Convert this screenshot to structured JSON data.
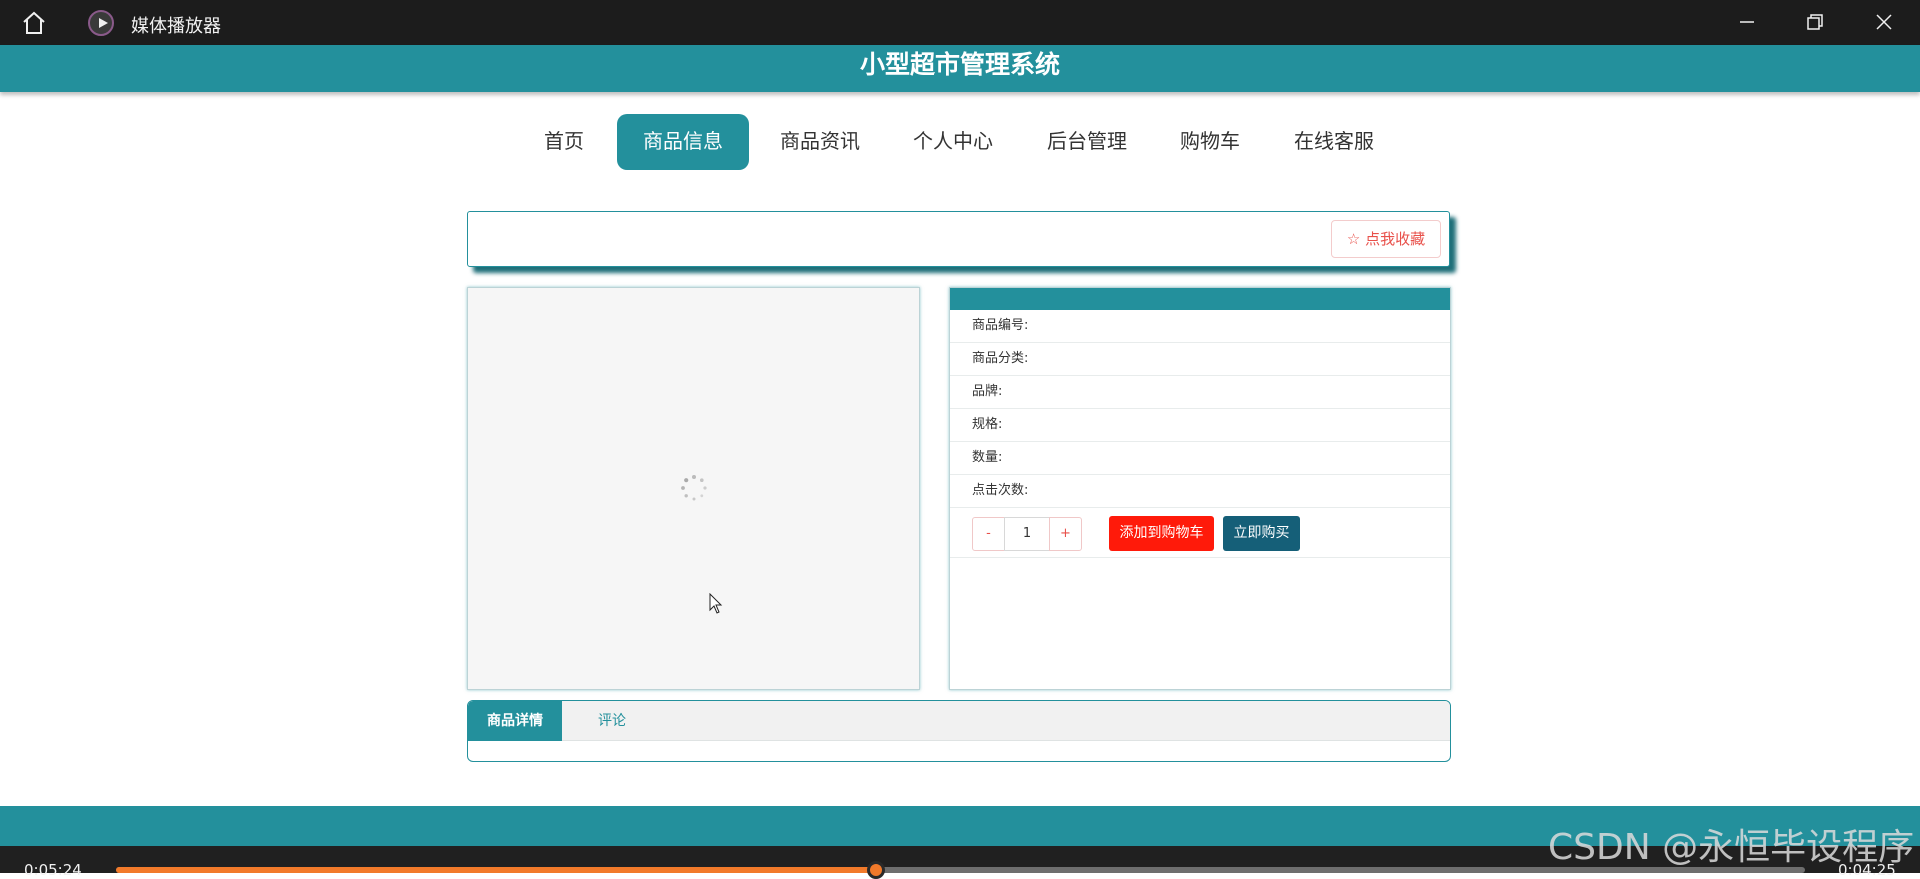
{
  "window": {
    "title": "媒体播放器",
    "icons": [
      "home-icon",
      "media-player-icon",
      "minimize-icon",
      "maximize-icon",
      "close-icon"
    ]
  },
  "site": {
    "title": "小型超市管理系统"
  },
  "nav": {
    "items": [
      {
        "label": "首页",
        "active": false
      },
      {
        "label": "商品信息",
        "active": true
      },
      {
        "label": "商品资讯",
        "active": false
      },
      {
        "label": "个人中心",
        "active": false
      },
      {
        "label": "后台管理",
        "active": false
      },
      {
        "label": "购物车",
        "active": false
      },
      {
        "label": "在线客服",
        "active": false
      }
    ]
  },
  "collect": {
    "icon": "star-outline-icon",
    "label": "点我收藏"
  },
  "product_info": {
    "fields": [
      {
        "label": "商品编号:"
      },
      {
        "label": "商品分类:"
      },
      {
        "label": "品牌:"
      },
      {
        "label": "规格:"
      },
      {
        "label": "数量:"
      },
      {
        "label": "点击次数:"
      }
    ],
    "quantity": {
      "minus_label": "-",
      "value": "1",
      "plus_label": "+"
    },
    "add_to_cart_label": "添加到购物车",
    "buy_now_label": "立即购买"
  },
  "tabs": [
    {
      "label": "商品详情",
      "active": true
    },
    {
      "label": "评论",
      "active": false
    }
  ],
  "player": {
    "elapsed": "0:05:24",
    "remaining": "0:04:25",
    "progress": 0.45
  },
  "watermark": "CSDN @永恒毕设程序",
  "colors": {
    "primary": "#23909c",
    "add_to_cart": "#ff1a0a",
    "buy_now": "#155f78",
    "collect_text": "#e8504a",
    "progress": "#f27a2a"
  }
}
